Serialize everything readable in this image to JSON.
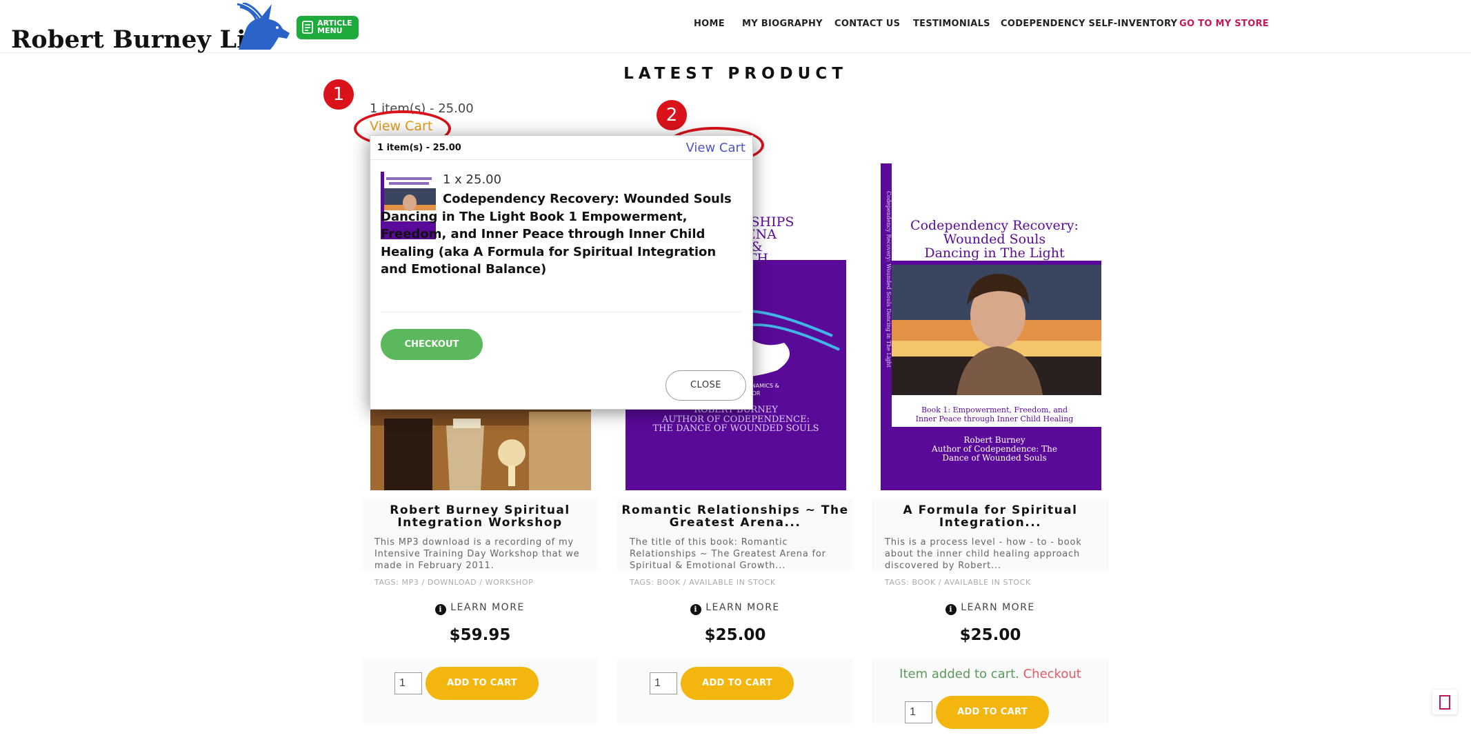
{
  "header": {
    "logo_text": "Robert Burney Live",
    "article_menu": {
      "line1": "ARTICLE",
      "line2": "MENU"
    },
    "nav": [
      {
        "label": "HOME"
      },
      {
        "label": "MY BIOGRAPHY"
      },
      {
        "label": "CONTACT US"
      },
      {
        "label": "TESTIMONIALS"
      },
      {
        "label": "CODEPENDENCY SELF-INVENTORY"
      },
      {
        "label": "GO TO MY STORE"
      }
    ]
  },
  "section_title": "LATEST PRODUCT",
  "mini_cart": {
    "summary": "1 item(s) - 25.00",
    "view_cart": "View Cart"
  },
  "markers": [
    "1",
    "2"
  ],
  "products": [
    {
      "title": "Robert Burney Spiritual Integration Workshop",
      "description": "This MP3 download is a recording of my Intensive Training Day Workshop that we made in February 2011.",
      "tags": "TAGS: MP3 / DOWNLOAD / WORKSHOP",
      "learn_more": "LEARN MORE",
      "price": "$59.95",
      "qty": "1",
      "add_to_cart": "ADD TO CART"
    },
    {
      "title": "Romantic Relationships ~ The Greatest Arena...",
      "description": "The title of this book: Romantic Relationships ~ The Greatest Arena for Spiritual & Emotional Growth...",
      "tags": "TAGS: BOOK / AVAILABLE IN STOCK",
      "learn_more": "LEARN MORE",
      "price": "$25.00",
      "qty": "1",
      "add_to_cart": "ADD TO CART",
      "cover": {
        "title_lines": [
          "RELATIONSHIPS",
          "EST ARENA",
          "TUAL &",
          "GROWTH"
        ],
        "subtitle_lines": [
          "ELATIONSHIP DYNAMICS &",
          "IP BEHAVIOR"
        ],
        "author_lines": [
          "ROBERT BURNEY",
          "AUTHOR OF CODEPENDENCE:",
          "THE DANCE OF WOUNDED SOULS"
        ]
      }
    },
    {
      "title": "A Formula for Spiritual Integration...",
      "description": "This is a process level - how - to - book about the inner child healing approach discovered by Robert...",
      "tags": "TAGS: BOOK / AVAILABLE IN STOCK",
      "learn_more": "LEARN MORE",
      "price": "$25.00",
      "qty": "1",
      "add_to_cart": "ADD TO CART",
      "added_message": "Item added to cart.",
      "added_checkout": "Checkout",
      "cover": {
        "title_lines": [
          "Codependency Recovery:",
          "Wounded Souls",
          "Dancing in The Light"
        ],
        "spine": "Codependency Recovery: Wounded Souls Dancing in The Light",
        "book_line": "Book 1: Empowerment, Freedom, and",
        "book_line2": "Inner Peace through Inner Child Healing",
        "author_lines": [
          "Robert Burney",
          "Author of Codependence: The",
          "Dance of Wounded Souls"
        ]
      }
    }
  ],
  "popup": {
    "count": "1 item(s) - 25.00",
    "view_cart": "View Cart",
    "line_qty": "1 x 25.00",
    "product_title": "Codependency Recovery: Wounded Souls Dancing in The Light Book 1 Empowerment, Freedom, and Inner Peace through Inner Child Healing (aka A Formula for Spiritual Integration and Emotional Balance)",
    "checkout": "CHECKOUT",
    "close": "CLOSE"
  },
  "colors": {
    "accent": "#f2b60f",
    "store_link": "#c2185b",
    "checkout_green": "#5cb85c",
    "marker_red": "#d9121b",
    "book_purple": "#5a0a99"
  }
}
